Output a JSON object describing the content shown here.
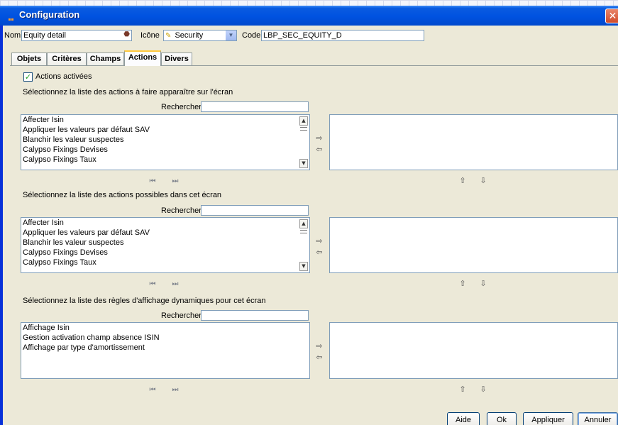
{
  "window": {
    "title": "Configuration",
    "close_glyph": "✕"
  },
  "header": {
    "nom_label": "Nom",
    "nom_value": "Equity detail",
    "icone_label": "Icône",
    "icone_value": "Security",
    "code_label": "Code",
    "code_value": "LBP_SEC_EQUITY_D"
  },
  "tabs": [
    {
      "label": "Objets",
      "active": false
    },
    {
      "label": "Critères",
      "active": false
    },
    {
      "label": "Champs",
      "active": false
    },
    {
      "label": "Actions",
      "active": true
    },
    {
      "label": "Divers",
      "active": false
    }
  ],
  "actions_enabled": {
    "label": "Actions activées",
    "checked": true
  },
  "sections": [
    {
      "title": "Sélectionnez la liste des actions à faire apparaître sur l'écran",
      "search_label": "Rechercher",
      "search_value": "",
      "items": [
        "Affecter Isin",
        "Appliquer les valeurs par défaut SAV",
        "Blanchir les valeur suspectes",
        "Calypso Fixings Devises",
        "Calypso Fixings Taux"
      ],
      "has_scrollbar": true
    },
    {
      "title": "Sélectionnez la liste des actions possibles dans cet écran",
      "search_label": "Rechercher",
      "search_value": "",
      "items": [
        "Affecter Isin",
        "Appliquer les valeurs par défaut SAV",
        "Blanchir les valeur suspectes",
        "Calypso Fixings Devises",
        "Calypso Fixings Taux"
      ],
      "has_scrollbar": true
    },
    {
      "title": "Sélectionnez la liste des règles d'affichage dynamiques pour cet écran",
      "search_label": "Rechercher",
      "search_value": "",
      "items": [
        "Affichage Isin",
        "Gestion activation champ absence ISIN",
        "Affichage par type d'amortissement"
      ],
      "has_scrollbar": false
    }
  ],
  "icons": {
    "first": "⏮",
    "last": "⏭",
    "move_right": "⇨",
    "move_left": "⇦",
    "move_up": "⇧",
    "move_down": "⇩"
  },
  "buttons": {
    "help": "Aide",
    "ok": "Ok",
    "apply": "Appliquer",
    "cancel": "Annuler"
  },
  "colors": {
    "title_bar": "#0052e0",
    "dialog_bg": "#ece9d8",
    "active_tab_accent": "#ffc83c"
  }
}
